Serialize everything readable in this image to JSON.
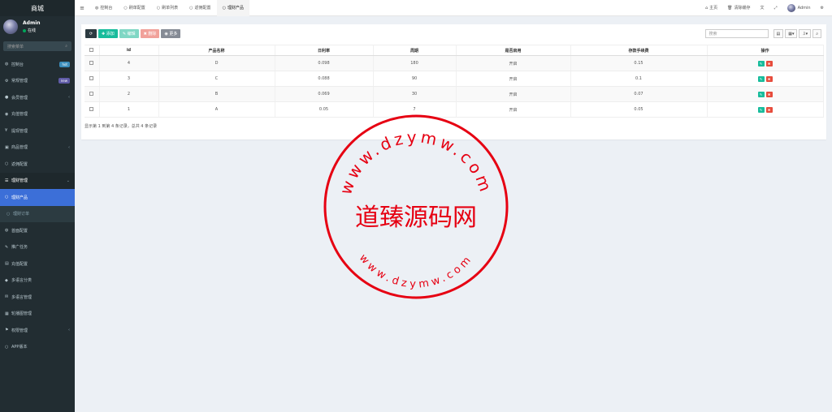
{
  "sidebar": {
    "brand": "商城",
    "user": {
      "name": "Admin",
      "status": "在线"
    },
    "search_placeholder": "搜索菜单",
    "items": [
      {
        "icon": "dashboard-icon",
        "glyph": "◍",
        "label": "控制台",
        "badge": "hot"
      },
      {
        "icon": "cogs-icon",
        "glyph": "⚙",
        "label": "常规管理",
        "badge": "new"
      },
      {
        "icon": "user-icon",
        "glyph": "●",
        "label": "会员管理",
        "chevron": "‹"
      },
      {
        "icon": "recharge-icon",
        "glyph": "◉",
        "label": "充值管理"
      },
      {
        "icon": "withdraw-icon",
        "glyph": "¥",
        "label": "提现管理"
      },
      {
        "icon": "product-icon",
        "glyph": "▣",
        "label": "商品管理",
        "chevron": "‹"
      },
      {
        "icon": "circle-icon",
        "glyph": "○",
        "label": "返佣配置"
      },
      {
        "icon": "list-icon",
        "glyph": "☰",
        "label": "理财管理",
        "chevron": "⌄"
      },
      {
        "icon": "circle-icon",
        "glyph": "○",
        "label": "理财产品"
      },
      {
        "icon": "circle-icon",
        "glyph": "○",
        "label": "理财订单"
      },
      {
        "icon": "home-config-icon",
        "glyph": "◍",
        "label": "首面配置"
      },
      {
        "icon": "promote-icon",
        "glyph": "✎",
        "label": "推广任务"
      },
      {
        "icon": "recharge-config-icon",
        "glyph": "▤",
        "label": "充值配置"
      },
      {
        "icon": "tag-icon",
        "glyph": "◆",
        "label": "多语言分类"
      },
      {
        "icon": "language-icon",
        "glyph": "✉",
        "label": "多语言管理"
      },
      {
        "icon": "carousel-icon",
        "glyph": "▦",
        "label": "轮播图管理"
      },
      {
        "icon": "permission-icon",
        "glyph": "⚑",
        "label": "权限管理",
        "chevron": "‹"
      },
      {
        "icon": "circle-icon",
        "glyph": "○",
        "label": "APP版本"
      }
    ]
  },
  "topnav": {
    "tabs": [
      {
        "icon": "dashboard-icon",
        "glyph": "◍",
        "label": "控制台"
      },
      {
        "icon": "circle-icon",
        "glyph": "○",
        "label": "刷单配置"
      },
      {
        "icon": "circle-icon",
        "glyph": "○",
        "label": "刷单列表"
      },
      {
        "icon": "circle-icon",
        "glyph": "○",
        "label": "返佣配置"
      },
      {
        "icon": "circle-icon",
        "glyph": "○",
        "label": "理财产品"
      }
    ],
    "home": "主页",
    "clear_cache": "清除缓存",
    "user": "Admin"
  },
  "toolbar": {
    "add": "添加",
    "edit": "编辑",
    "delete": "删除",
    "more": "更多",
    "search_placeholder": "搜索"
  },
  "table": {
    "columns": [
      "id",
      "产品名称",
      "日利率",
      "周期",
      "是否启用",
      "存款手续费",
      "操作"
    ],
    "rows": [
      {
        "id": "4",
        "name": "D",
        "rate": "0.098",
        "period": "180",
        "enabled": "开启",
        "fee": "0.15"
      },
      {
        "id": "3",
        "name": "C",
        "rate": "0.088",
        "period": "90",
        "enabled": "开启",
        "fee": "0.1"
      },
      {
        "id": "2",
        "name": "B",
        "rate": "0.069",
        "period": "30",
        "enabled": "开启",
        "fee": "0.07"
      },
      {
        "id": "1",
        "name": "A",
        "rate": "0.05",
        "period": "7",
        "enabled": "开启",
        "fee": "0.05"
      }
    ],
    "summary": "显示第 1 到第 4 条记录，总共 4 条记录"
  },
  "watermark": {
    "title": "道臻源码网",
    "url": "www.dzymw.com",
    "color": "#e60012"
  }
}
